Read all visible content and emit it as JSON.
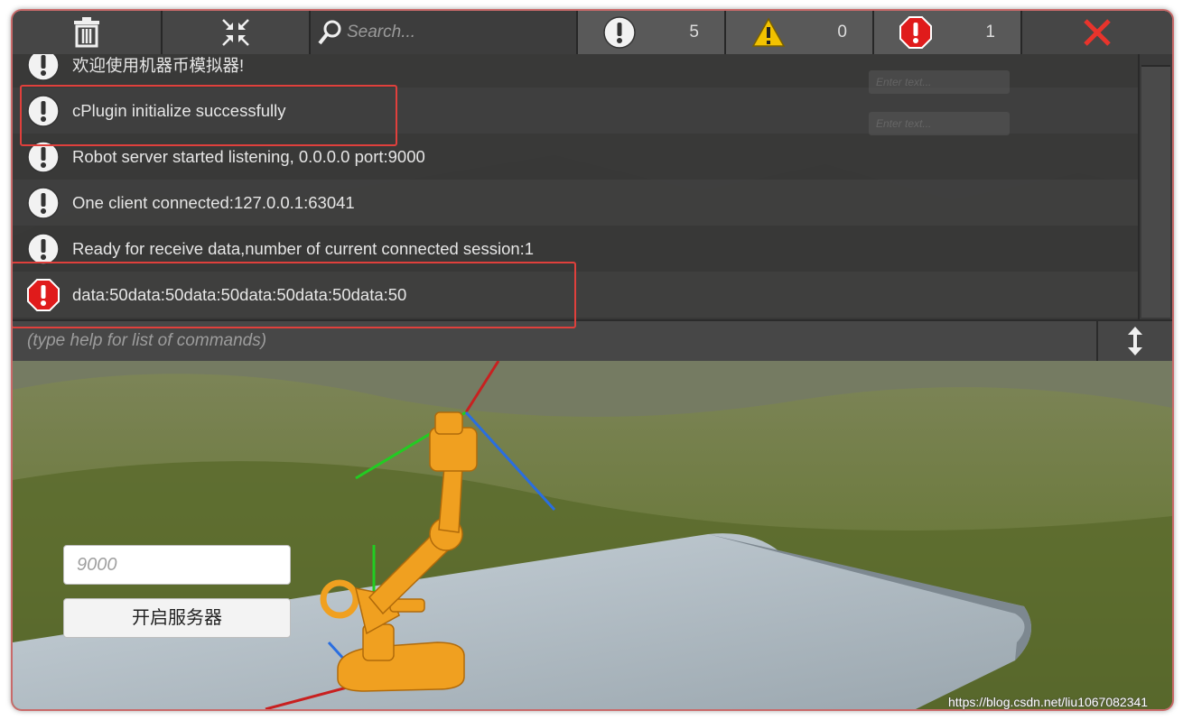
{
  "toolbar": {
    "search_placeholder": "Search...",
    "info_count": "5",
    "warning_count": "0",
    "error_count": "1"
  },
  "log": [
    {
      "level": "info",
      "text": "欢迎使用机器币模拟器!"
    },
    {
      "level": "info",
      "text": "cPlugin initialize successfully"
    },
    {
      "level": "info",
      "text": "Robot server started listening, 0.0.0.0 port:9000"
    },
    {
      "level": "info",
      "text": "One client connected:127.0.0.1:63041"
    },
    {
      "level": "info",
      "text": "Ready for receive data,number of current connected session:1"
    },
    {
      "level": "error",
      "text": "data:50data:50data:50data:50data:50data:50"
    }
  ],
  "ghost_fields": [
    "Enter text...",
    "Enter text..."
  ],
  "command": {
    "placeholder": "(type help for list of commands)"
  },
  "server": {
    "port_value": "9000",
    "start_label": "开启服务器"
  },
  "watermark": "https://blog.csdn.net/liu1067082341",
  "colors": {
    "error": "#e01b1b",
    "warning": "#f2c200",
    "info": "#f2f2f2",
    "highlight": "#e0403c",
    "robot": "#f0a020"
  }
}
